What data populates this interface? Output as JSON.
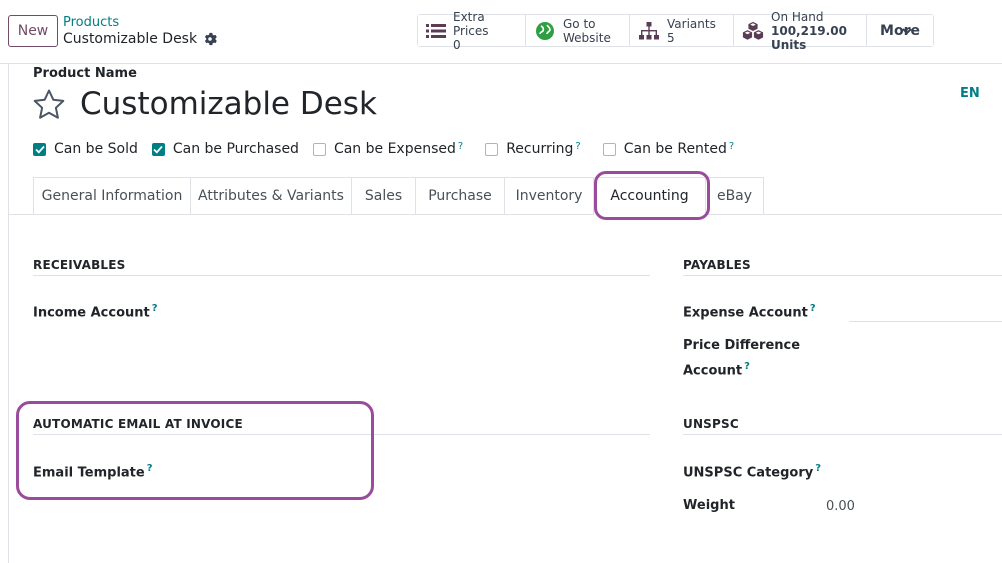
{
  "control_panel": {
    "new_label": "New",
    "breadcrumb": "Products",
    "record_title": "Customizable Desk"
  },
  "smart_buttons": {
    "extra_prices": {
      "label": "Extra Prices",
      "value": "0"
    },
    "go_to_website": {
      "label_line1": "Go to",
      "label_line2": "Website"
    },
    "variants": {
      "label": "Variants",
      "value": "5"
    },
    "on_hand": {
      "label": "On Hand",
      "value": "100,219.00 Units"
    },
    "more_label": "More"
  },
  "form": {
    "product_name_label": "Product Name",
    "product_name": "Customizable Desk",
    "language": "EN",
    "checkboxes": [
      {
        "label": "Can be Sold",
        "checked": true,
        "help": ""
      },
      {
        "label": "Can be Purchased",
        "checked": true,
        "help": ""
      },
      {
        "label": "Can be Expensed",
        "checked": false,
        "help": "?"
      },
      {
        "label": "Recurring",
        "checked": false,
        "help": "?"
      },
      {
        "label": "Can be Rented",
        "checked": false,
        "help": "?"
      }
    ]
  },
  "tabs": [
    {
      "label": "General Information",
      "active": false
    },
    {
      "label": "Attributes & Variants",
      "active": false
    },
    {
      "label": "Sales",
      "active": false
    },
    {
      "label": "Purchase",
      "active": false
    },
    {
      "label": "Inventory",
      "active": false
    },
    {
      "label": "Accounting",
      "active": true
    },
    {
      "label": "eBay",
      "active": false
    }
  ],
  "accounting": {
    "receivables": {
      "title": "RECEIVABLES",
      "income_account_label": "Income Account",
      "help": "?"
    },
    "payables": {
      "title": "PAYABLES",
      "expense_account_label": "Expense Account",
      "price_difference_line1": "Price Difference",
      "price_difference_line2": "Account",
      "help": "?"
    },
    "auto_email": {
      "title": "AUTOMATIC EMAIL AT INVOICE",
      "email_template_label": "Email Template",
      "help": "?"
    },
    "unspsc": {
      "title": "UNSPSC",
      "category_label": "UNSPSC Category",
      "help": "?",
      "weight_label": "Weight",
      "weight_value": "0.00"
    }
  },
  "colors": {
    "brand": "#714b67",
    "accent": "#017e84",
    "highlight": "#9b4b9b"
  }
}
